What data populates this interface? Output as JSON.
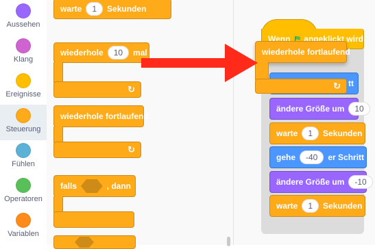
{
  "sidebar": {
    "categories": [
      {
        "label": "Aussehen",
        "color": "#9966ff"
      },
      {
        "label": "Klang",
        "color": "#cf63cf"
      },
      {
        "label": "Ereignisse",
        "color": "#ffbf00"
      },
      {
        "label": "Steuerung",
        "color": "#ffab19",
        "active": true
      },
      {
        "label": "Fühlen",
        "color": "#5cb1d6"
      },
      {
        "label": "Operatoren",
        "color": "#59c059"
      },
      {
        "label": "Variablen",
        "color": "#ff8c1a"
      }
    ]
  },
  "palette": {
    "wait": {
      "text": "warte",
      "value": "1",
      "unit": "Sekunden"
    },
    "repeat": {
      "text_before": "wiederhole",
      "value": "10",
      "text_after": "mal",
      "loop_icon": "↻"
    },
    "forever": {
      "text": "wiederhole fortlaufend",
      "loop_icon": "↻"
    },
    "if_then": {
      "text_before": "falls",
      "text_after": ", dann"
    }
  },
  "script": {
    "hat": {
      "text_before": "Wenn",
      "flag_icon": "green-flag",
      "text_after": "angeklickt wird"
    },
    "dragged_forever": {
      "text": "wiederhole fortlaufend",
      "loop_icon": "↻"
    },
    "hidden_partial_text": "tt",
    "blocks": [
      {
        "text_before": "ändere Größe um",
        "value": "10"
      },
      {
        "text_before": "warte",
        "value": "1",
        "text_after": "Sekunden"
      },
      {
        "text_before": "gehe",
        "value": "-40",
        "text_after": "er Schritt"
      },
      {
        "text_before": "ändere Größe um",
        "value": "-10"
      },
      {
        "text_before": "warte",
        "value": "1",
        "text_after": "Sekunden"
      }
    ]
  },
  "colors": {
    "control": "#ffab19",
    "looks": "#9966ff",
    "motion": "#4c97ff",
    "events": "#ffbf00",
    "arrow": "#ff2a1a"
  }
}
